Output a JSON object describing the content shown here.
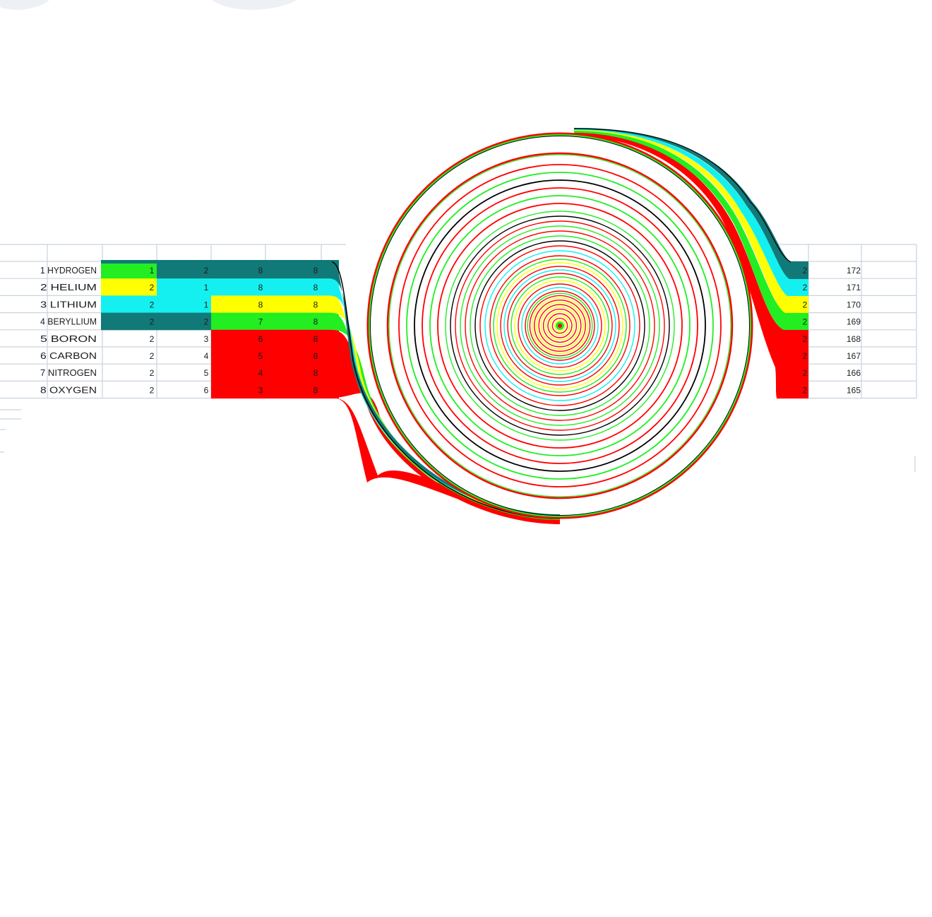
{
  "colors": {
    "teal": "#117a78",
    "cyan": "#14f0f0",
    "yellow": "#ffff00",
    "green": "#22ee22",
    "red": "#ff0000",
    "black": "#000000",
    "grid": "#c9d3de"
  },
  "table_left": {
    "rows": [
      {
        "label": "1 HYDROGEN",
        "values": [
          "1",
          "2",
          "8",
          "8"
        ],
        "fills": [
          "green",
          "teal",
          "teal",
          "teal"
        ]
      },
      {
        "label": "2 HELIUM",
        "values": [
          "2",
          "1",
          "8",
          "8"
        ],
        "fills": [
          "yellow",
          "cyan",
          "cyan",
          "cyan"
        ]
      },
      {
        "label": "3 LITHIUM",
        "values": [
          "2",
          "1",
          "8",
          "8"
        ],
        "fills": [
          "cyan",
          "cyan",
          "yellow",
          "yellow"
        ]
      },
      {
        "label": "4 BERYLLIUM",
        "values": [
          "2",
          "2",
          "7",
          "8"
        ],
        "fills": [
          "teal",
          "teal",
          "green",
          "green"
        ]
      },
      {
        "label": "5 BORON",
        "values": [
          "2",
          "3",
          "6",
          "8"
        ],
        "fills": [
          "white",
          "white",
          "red",
          "red"
        ]
      },
      {
        "label": "6 CARBON",
        "values": [
          "2",
          "4",
          "5",
          "8"
        ],
        "fills": [
          "white",
          "white",
          "red",
          "red"
        ]
      },
      {
        "label": "7 NITROGEN",
        "values": [
          "2",
          "5",
          "4",
          "8"
        ],
        "fills": [
          "white",
          "white",
          "red",
          "red"
        ]
      },
      {
        "label": "8 OXYGEN",
        "values": [
          "2",
          "6",
          "3",
          "8"
        ],
        "fills": [
          "white",
          "white",
          "red",
          "red"
        ]
      }
    ]
  },
  "table_right": {
    "rows": [
      {
        "value": "2",
        "number": "172",
        "fill": "teal"
      },
      {
        "value": "2",
        "number": "171",
        "fill": "cyan"
      },
      {
        "value": "2",
        "number": "170",
        "fill": "yellow"
      },
      {
        "value": "2",
        "number": "169",
        "fill": "green"
      },
      {
        "value": "2",
        "number": "168",
        "fill": "red"
      },
      {
        "value": "2",
        "number": "167",
        "fill": "red"
      },
      {
        "value": "2",
        "number": "166",
        "fill": "red"
      },
      {
        "value": "2",
        "number": "165",
        "fill": "red"
      }
    ]
  },
  "spiral": {
    "ring_colors": [
      "red",
      "green",
      "black",
      "yellow",
      "cyan"
    ]
  }
}
